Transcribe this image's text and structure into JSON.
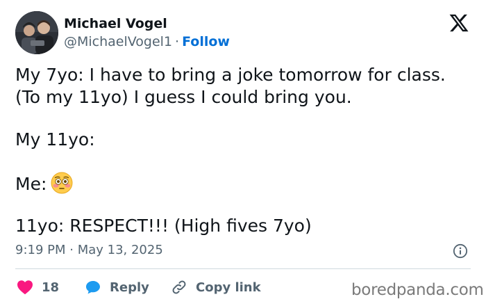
{
  "author": {
    "name": "Michael Vogel",
    "handle": "@MichaelVogel1",
    "separator": "·",
    "follow_label": "Follow"
  },
  "tweet": {
    "lines": [
      "My 7yo: I have to bring a joke tomorrow for class.",
      "(To my 11yo) I guess I could bring you.",
      "My 11yo:",
      "Me:",
      "11yo: RESPECT!!! (High fives 7yo)"
    ],
    "emoji": "flushed-face"
  },
  "timestamp": "9:19 PM · May 13, 2025",
  "actions": {
    "like_count": "18",
    "reply_label": "Reply",
    "copy_link_label": "Copy link"
  },
  "watermark": "boredpanda.com",
  "colors": {
    "text": "#0f1419",
    "secondary": "#536471",
    "link": "#006fd6",
    "like": "#f91880",
    "reply": "#1d9bf0",
    "divider": "#cfd9de"
  }
}
